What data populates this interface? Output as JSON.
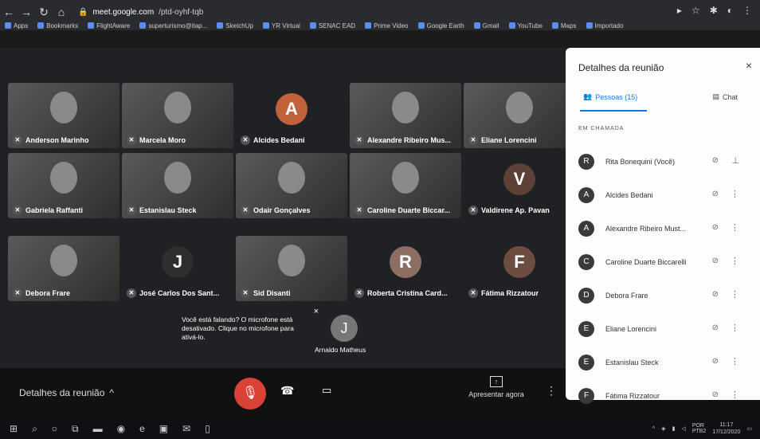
{
  "browser": {
    "url_host": "meet.google.com",
    "url_path": "/ptd-oyhf-tqb",
    "bookmarks": [
      "Apps",
      "Bookmarks",
      "FlightAware",
      "superturismo@itap...",
      "SketchUp",
      "YR Virtual",
      "SENAC EAD",
      "Prime Video",
      "Google Earth",
      "Gmail",
      "YouTube",
      "Maps",
      "Importado"
    ]
  },
  "tiles": [
    {
      "name": "Anderson Marinho",
      "type": "video"
    },
    {
      "name": "Marcela Moro",
      "type": "video"
    },
    {
      "name": "Alcides Bedani",
      "type": "avatar",
      "initial": "A",
      "color": "#c2623a"
    },
    {
      "name": "Alexandre Ribeiro Mus...",
      "type": "video"
    },
    {
      "name": "Eliane Lorencini",
      "type": "video"
    },
    {
      "name": "Gabriela Raffanti",
      "type": "video"
    },
    {
      "name": "Estanislau Steck",
      "type": "video"
    },
    {
      "name": "Odair Gonçalves",
      "type": "video"
    },
    {
      "name": "Caroline Duarte Biccar...",
      "type": "video"
    },
    {
      "name": "Valdirene Ap. Pavan",
      "type": "avatar",
      "initial": "V",
      "color": "#5d4037"
    },
    {
      "name": "Debora Frare",
      "type": "video"
    },
    {
      "name": "José Carlos Dos Sant...",
      "type": "avatar",
      "initial": "J",
      "color": "#2e2e2e"
    },
    {
      "name": "Sid Disanti",
      "type": "video"
    },
    {
      "name": "Roberta Cristina Card...",
      "type": "avatar",
      "initial": "R",
      "color": "#8d6e63"
    },
    {
      "name": "Fátima Rizzatour",
      "type": "avatar",
      "initial": "F",
      "color": "#6d4c41"
    }
  ],
  "tip": {
    "text": "Você está falando? O microfone está desativado. Clique no microfone para ativá-lo.",
    "close": "×"
  },
  "floating": {
    "initial": "J",
    "name": "Arnaldo Matheus"
  },
  "bottombar": {
    "meeting_details": "Detalhes da reunião",
    "chevron": "^",
    "present_label": "Apresentar agora"
  },
  "panel": {
    "title": "Detalhes da reunião",
    "close": "×",
    "tab_people": "Pessoas (15)",
    "tab_chat": "Chat",
    "section_label": "EM CHAMADA",
    "people": [
      {
        "name": "Rita Bonequini (Você)",
        "initial": "R"
      },
      {
        "name": "Alcides Bedani",
        "initial": "A"
      },
      {
        "name": "Alexandre Ribeiro Must...",
        "initial": "A"
      },
      {
        "name": "Caroline Duarte Biccarelli",
        "initial": "C"
      },
      {
        "name": "Debora Frare",
        "initial": "D"
      },
      {
        "name": "Eliane Lorencini",
        "initial": "E"
      },
      {
        "name": "Estanislau Steck",
        "initial": "E"
      },
      {
        "name": "Fátima Rizzatour",
        "initial": "F"
      }
    ]
  },
  "taskbar": {
    "lang": "POR",
    "lang2": "PTB2",
    "time": "11:17",
    "date": "17/12/2020"
  }
}
